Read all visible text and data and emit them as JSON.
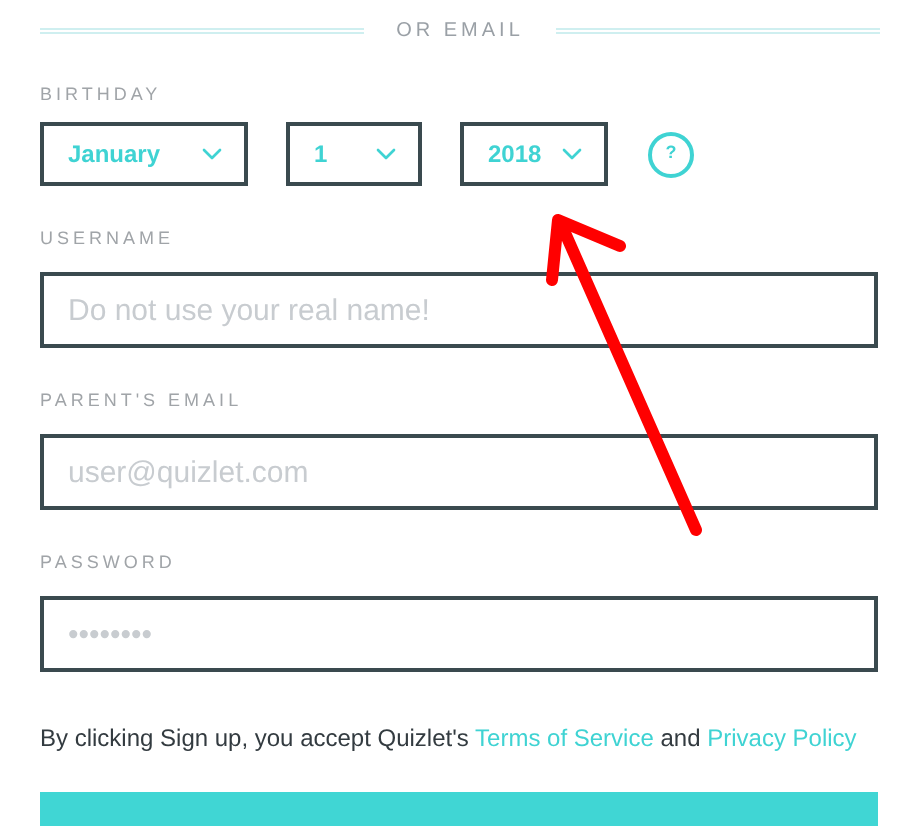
{
  "divider": {
    "label": "OR EMAIL"
  },
  "birthday": {
    "label": "BIRTHDAY",
    "selects": [
      {
        "value": "January"
      },
      {
        "value": "1"
      },
      {
        "value": "2018"
      }
    ],
    "help": "?"
  },
  "fields": [
    {
      "label": "USERNAME",
      "placeholder": "Do not use your real name!"
    },
    {
      "label": "PARENT'S EMAIL",
      "placeholder": "user@quizlet.com"
    },
    {
      "label": "PASSWORD",
      "placeholder": "••••••••"
    }
  ],
  "terms": {
    "text": "By clicking Sign up, you accept Quizlet's",
    "link1": "Terms of Service",
    "and": "and",
    "link2": "Privacy Policy"
  }
}
